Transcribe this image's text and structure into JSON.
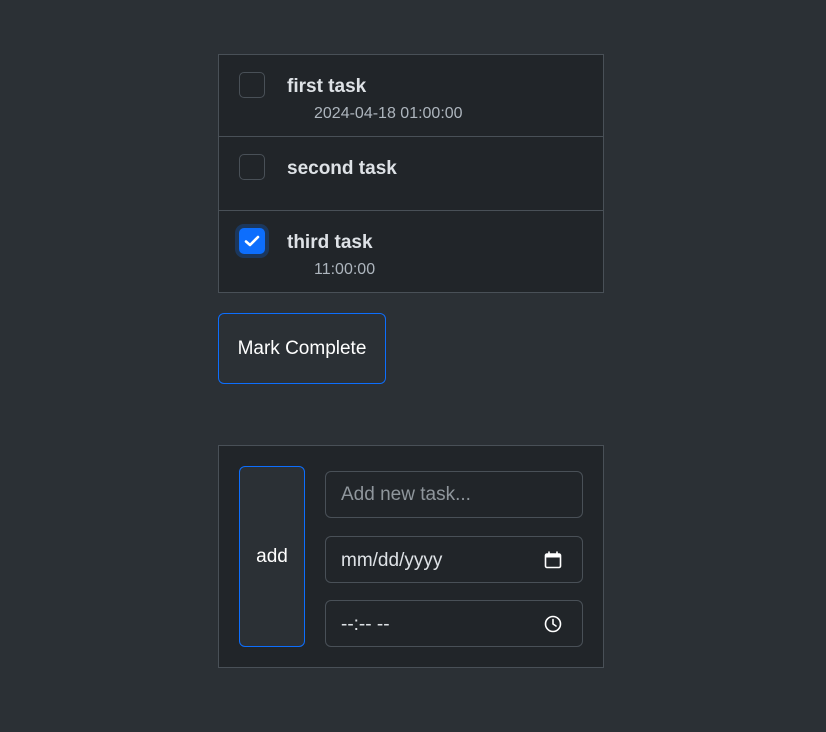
{
  "tasks": [
    {
      "title": "first task",
      "datetime": "2024-04-18 01:00:00",
      "checked": false
    },
    {
      "title": "second task",
      "datetime": "",
      "checked": false
    },
    {
      "title": "third task",
      "datetime": "11:00:00",
      "checked": true
    }
  ],
  "actions": {
    "mark_complete_label": "Mark Complete",
    "add_label": "add"
  },
  "new_task": {
    "name_placeholder": "Add new task...",
    "date_value": "mm/dd/yyyy",
    "time_value": "--:-- --",
    "date_icon": "calendar-icon",
    "time_icon": "clock-icon"
  },
  "colors": {
    "page_bg": "#2b3035",
    "panel_bg": "#212529",
    "border": "#495057",
    "accent": "#0d6efd",
    "text": "#dee2e6",
    "muted": "#adb5bd"
  }
}
